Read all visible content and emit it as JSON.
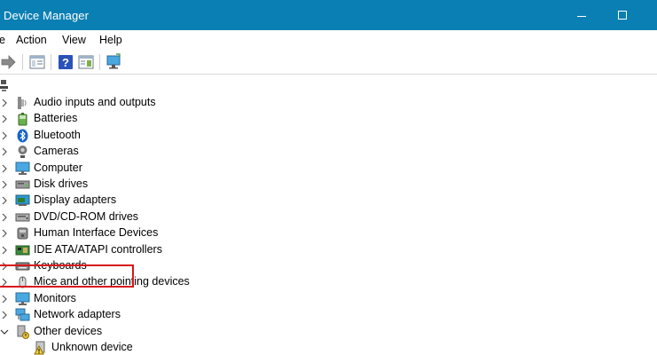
{
  "window": {
    "title": "Device Manager"
  },
  "menu": [
    "e",
    "Action",
    "View",
    "Help"
  ],
  "tree": {
    "items": [
      {
        "label": "Audio inputs and outputs",
        "icon": "speaker-icon",
        "expanded": false
      },
      {
        "label": "Batteries",
        "icon": "battery-icon",
        "expanded": false
      },
      {
        "label": "Bluetooth",
        "icon": "bluetooth-icon",
        "expanded": false
      },
      {
        "label": "Cameras",
        "icon": "camera-icon",
        "expanded": false
      },
      {
        "label": "Computer",
        "icon": "monitor-icon",
        "expanded": false
      },
      {
        "label": "Disk drives",
        "icon": "disk-drive-icon",
        "expanded": false
      },
      {
        "label": "Display adapters",
        "icon": "display-adapter-icon",
        "expanded": false,
        "highlighted": true
      },
      {
        "label": "DVD/CD-ROM drives",
        "icon": "dvd-drive-icon",
        "expanded": false
      },
      {
        "label": "Human Interface Devices",
        "icon": "hid-icon",
        "expanded": false
      },
      {
        "label": "IDE ATA/ATAPI controllers",
        "icon": "ide-controller-icon",
        "expanded": false
      },
      {
        "label": "Keyboards",
        "icon": "keyboard-icon",
        "expanded": false
      },
      {
        "label": "Mice and other pointing devices",
        "icon": "mouse-icon",
        "expanded": false
      },
      {
        "label": "Monitors",
        "icon": "monitor-icon",
        "expanded": false
      },
      {
        "label": "Network adapters",
        "icon": "network-adapter-icon",
        "expanded": false
      },
      {
        "label": "Other devices",
        "icon": "other-devices-icon",
        "expanded": true
      },
      {
        "label": "Unknown device",
        "icon": "warning-device-icon",
        "child": true
      }
    ]
  },
  "colors": {
    "titlebar": "#0a7fb3",
    "highlight": "#d8161c"
  }
}
